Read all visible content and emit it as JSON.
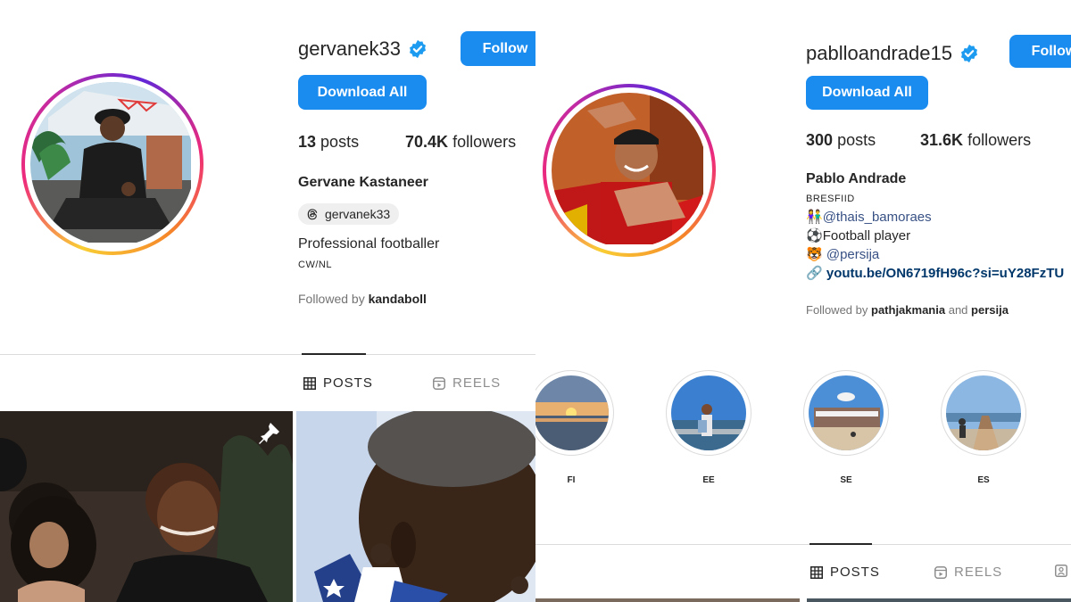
{
  "left_profile": {
    "username": "gervanek33",
    "follow_label": "Follow",
    "download_label": "Download All",
    "posts_count": "13",
    "posts_label": "posts",
    "followers_count": "70.4K",
    "followers_label": "followers",
    "full_name": "Gervane Kastaneer",
    "threads_handle": "gervanek33",
    "bio_line1": "Professional footballer",
    "bio_line2": "CW/NL",
    "followed_by_prefix": "Followed by",
    "followed_by_user": "kandaboll",
    "tabs": {
      "posts": "POSTS",
      "reels": "REELS"
    }
  },
  "right_profile": {
    "username": "pablloandrade15",
    "follow_label": "Follow",
    "download_label": "Download All",
    "posts_count": "300",
    "posts_label": "posts",
    "followers_count": "31.6K",
    "followers_label": "followers",
    "full_name": "Pablo Andrade",
    "bio_tag": "BRESFIID",
    "bio_mention1": "@thais_bamoraes",
    "bio_line2": "Football player",
    "bio_mention2": "@persija",
    "bio_link": "youtu.be/ON6719fH96c?si=uY28FzTU",
    "followed_by_prefix": "Followed by",
    "followed_by_user1": "pathjakmania",
    "followed_by_and": "and",
    "followed_by_user2": "persija",
    "highlights": [
      {
        "label": "FI"
      },
      {
        "label": "EE"
      },
      {
        "label": "SE"
      },
      {
        "label": "ES"
      }
    ],
    "tabs": {
      "posts": "POSTS",
      "reels": "REELS"
    }
  },
  "colors": {
    "accent": "#1a8cf0",
    "verified": "#1d9bf0",
    "text": "#262626",
    "muted": "#737373",
    "divider": "#dbdbdb"
  }
}
